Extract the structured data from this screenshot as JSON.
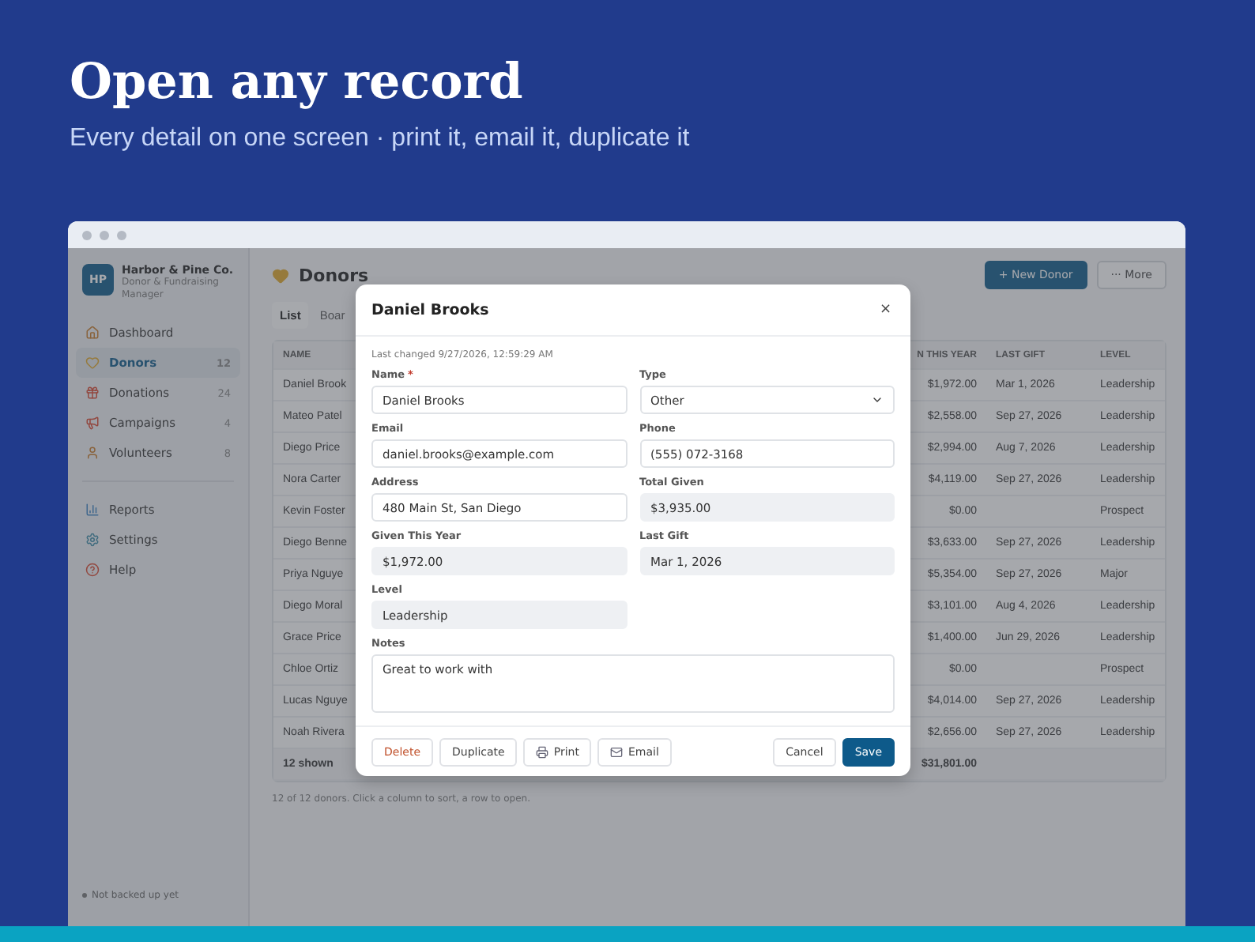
{
  "hero": {
    "title": "Open any record",
    "subtitle": "Every detail on one screen · print it, email it, duplicate it"
  },
  "sidebar": {
    "logo": "HP",
    "org": "Harbor & Pine Co.",
    "tagline": "Donor & Fundraising Manager",
    "items": [
      {
        "label": "Dashboard",
        "selected": false,
        "kind": "house"
      },
      {
        "label": "Donors",
        "count": "12",
        "selected": true,
        "kind": "heart"
      },
      {
        "label": "Donations",
        "count": "24",
        "selected": false,
        "kind": "gift"
      },
      {
        "label": "Campaigns",
        "count": "4",
        "selected": false,
        "kind": "megaphone"
      },
      {
        "label": "Volunteers",
        "count": "8",
        "selected": false,
        "kind": "person"
      },
      {
        "label": "Reports",
        "selected": false,
        "kind": "chart"
      },
      {
        "label": "Settings",
        "selected": false,
        "kind": "gear"
      },
      {
        "label": "Help",
        "selected": false,
        "kind": "help"
      }
    ],
    "status": "Not backed up yet"
  },
  "page": {
    "title": "Donors",
    "buttons": [
      {
        "label": "+ New Donor",
        "kind": "primary"
      },
      {
        "label": "··· More",
        "kind": "plain"
      }
    ],
    "tabs": [
      {
        "label": "List",
        "selected": true
      },
      {
        "label": "Boar",
        "selected": false
      }
    ],
    "table": {
      "columns": [
        "NAME",
        "N THIS YEAR",
        "LAST GIFT",
        "LEVEL"
      ],
      "rows": [
        [
          "Daniel Brook",
          "$1,972.00",
          "Mar 1, 2026",
          "Leadership"
        ],
        [
          "Mateo Patel",
          "$2,558.00",
          "Sep 27, 2026",
          "Leadership"
        ],
        [
          "Diego Price",
          "$2,994.00",
          "Aug 7, 2026",
          "Leadership"
        ],
        [
          "Nora Carter",
          "$4,119.00",
          "Sep 27, 2026",
          "Leadership"
        ],
        [
          "Kevin Foster",
          "$0.00",
          "",
          "Prospect"
        ],
        [
          "Diego Benne",
          "$3,633.00",
          "Sep 27, 2026",
          "Leadership"
        ],
        [
          "Priya Nguye",
          "$5,354.00",
          "Sep 27, 2026",
          "Major"
        ],
        [
          "Diego Moral",
          "$3,101.00",
          "Aug 4, 2026",
          "Leadership"
        ],
        [
          "Grace Price",
          "$1,400.00",
          "Jun 29, 2026",
          "Leadership"
        ],
        [
          "Chloe Ortiz",
          "$0.00",
          "",
          "Prospect"
        ],
        [
          "Lucas Nguye",
          "$4,014.00",
          "Sep 27, 2026",
          "Leadership"
        ],
        [
          "Noah Rivera",
          "$2,656.00",
          "Sep 27, 2026",
          "Leadership"
        ]
      ],
      "footer": [
        "12 shown",
        "$31,801.00"
      ]
    },
    "hint": "12 of 12 donors. Click a column to sort, a row to open."
  },
  "dialog": {
    "title": "Daniel Brooks",
    "close": "×",
    "changed": "Last changed 9/27/2026, 12:59:29 AM",
    "fields": [
      {
        "label": "Name",
        "required_mark": "*",
        "value": "Daniel Brooks",
        "kind": "text"
      },
      {
        "label": "Type",
        "value": "Other",
        "kind": "select"
      },
      {
        "label": "Email",
        "value": "daniel.brooks@example.com",
        "kind": "text"
      },
      {
        "label": "Phone",
        "value": "(555) 072-3168",
        "kind": "text"
      },
      {
        "label": "Address",
        "value": "480 Main St, San Diego",
        "kind": "text"
      },
      {
        "label": "Total Given",
        "value": "$3,935.00",
        "kind": "readonly"
      },
      {
        "label": "Given This Year",
        "value": "$1,972.00",
        "kind": "readonly"
      },
      {
        "label": "Last Gift",
        "value": "Mar 1, 2026",
        "kind": "readonly"
      },
      {
        "label": "Level",
        "value": "Leadership",
        "kind": "readonly"
      },
      {
        "label": "Notes",
        "value": "Great to work with",
        "kind": "textarea"
      }
    ],
    "left_buttons": [
      {
        "label": "Delete",
        "kind": "danger"
      },
      {
        "label": "Duplicate",
        "kind": "plain"
      },
      {
        "label": "Print",
        "kind": "print"
      },
      {
        "label": "Email",
        "kind": "email"
      }
    ],
    "right_buttons": [
      {
        "label": "Cancel",
        "kind": "plain"
      },
      {
        "label": "Save",
        "kind": "primary"
      }
    ]
  }
}
